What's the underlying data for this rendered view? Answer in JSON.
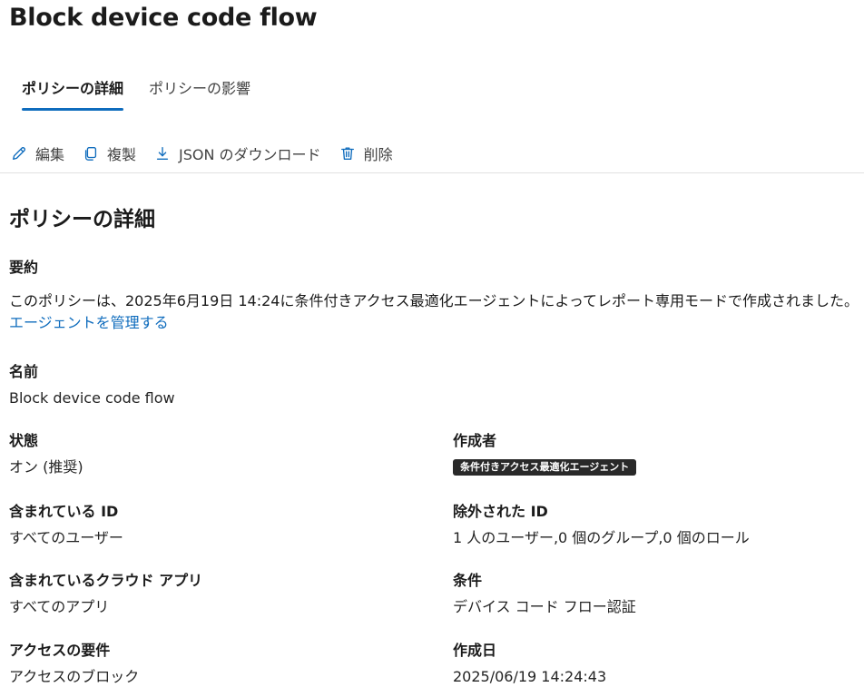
{
  "page": {
    "title": "Block device code flow"
  },
  "tabs": [
    {
      "label": "ポリシーの詳細",
      "active": true
    },
    {
      "label": "ポリシーの影響",
      "active": false
    }
  ],
  "toolbar": {
    "edit_label": "編集",
    "duplicate_label": "複製",
    "download_json_label": "JSON のダウンロード",
    "delete_label": "削除"
  },
  "details": {
    "section_title": "ポリシーの詳細",
    "summary_label": "要約",
    "summary_text": "このポリシーは、2025年6月19日 14:24に条件付きアクセス最適化エージェントによってレポート専用モードで作成されました。",
    "manage_agent_link": "エージェントを管理する",
    "name": {
      "label": "名前",
      "value": "Block device code flow"
    },
    "state": {
      "label": "状態",
      "value": "オン (推奨)"
    },
    "created_by": {
      "label": "作成者",
      "value": "条件付きアクセス最適化エージェント"
    },
    "included_ids": {
      "label": "含まれている ID",
      "value": "すべてのユーザー"
    },
    "excluded_ids": {
      "label": "除外された ID",
      "value": "1 人のユーザー,0 個のグループ,0 個のロール"
    },
    "included_apps": {
      "label": "含まれているクラウド アプリ",
      "value": "すべてのアプリ"
    },
    "conditions": {
      "label": "条件",
      "value": "デバイス コード フロー認証"
    },
    "access_requirements": {
      "label": "アクセスの要件",
      "value": "アクセスのブロック"
    },
    "created_date": {
      "label": "作成日",
      "value": "2025/06/19 14:24:43"
    }
  },
  "colors": {
    "accent": "#0f6cbd",
    "badge_background": "#292929",
    "divider": "#e1e1e1"
  }
}
